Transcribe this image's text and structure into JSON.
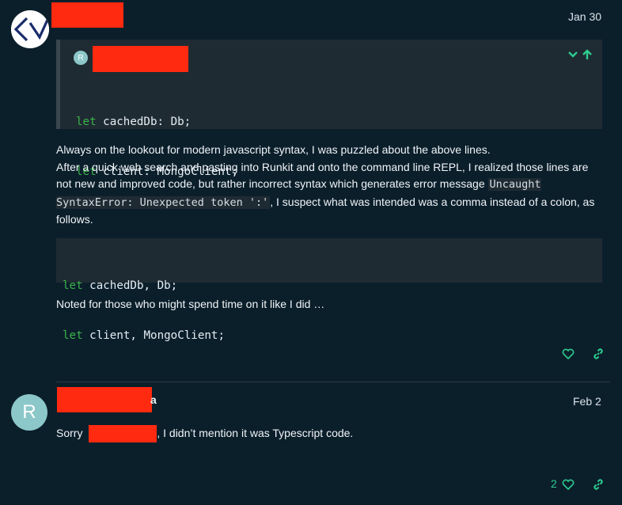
{
  "post1": {
    "date": "Jan 30",
    "quote": {
      "avatar_letter": "R",
      "code": [
        {
          "kw": "let",
          "rest": " cachedDb: Db;"
        },
        {
          "kw": "let",
          "rest": " client: MongoClient;"
        }
      ]
    },
    "body": {
      "line1": "Always on the lookout for modern javascript syntax, I was puzzled about the above lines.",
      "line2_a": "After a quick web search and pasting into Runkit and onto the command line REPL, I realized those lines are not new and improved code, but rather incorrect syntax which generates error message ",
      "line2_code": "Uncaught SyntaxError: Unexpected token ':'",
      "line2_b": ", I suspect what was intended was a comma instead of a colon, as follows."
    },
    "code2": [
      {
        "kw": "let",
        "rest": " cachedDb, Db;"
      },
      {
        "kw": "let",
        "rest": " client, MongoClient;"
      }
    ],
    "closing": "Noted for those who might spend time on it like I did …"
  },
  "post2": {
    "avatar_letter": "R",
    "name_tail": "a",
    "date": "Feb 2",
    "text_a": "Sorry ",
    "text_b": ", I didn’t mention it was Typescript code.",
    "like_count": "2"
  },
  "colors": {
    "background": "#0b1f2b",
    "accent": "#2ecc8f",
    "redaction": "#ff2a0f"
  }
}
